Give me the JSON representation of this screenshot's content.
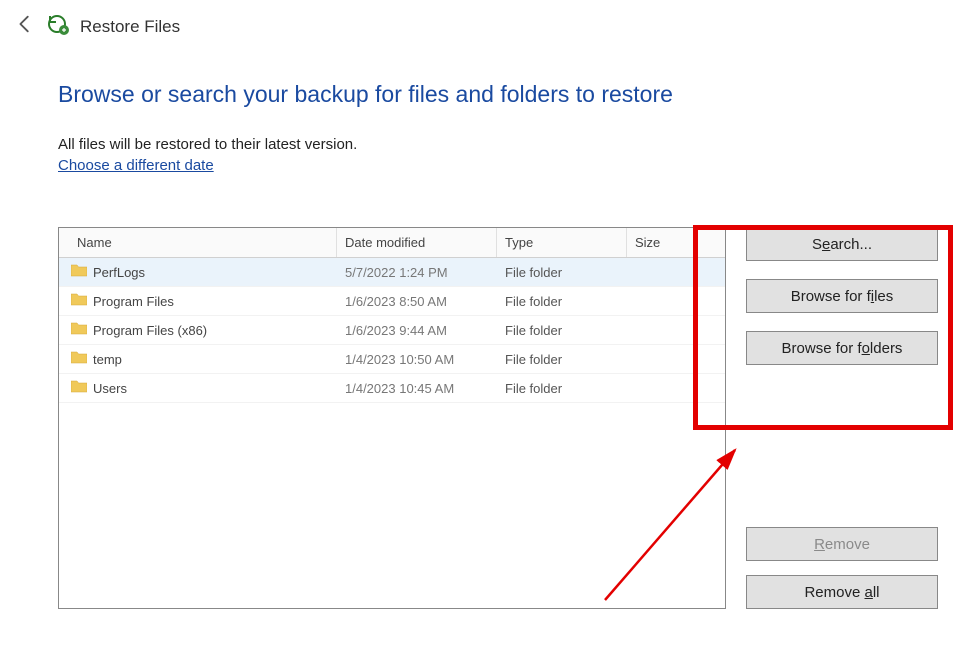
{
  "titlebar": {
    "title": "Restore Files"
  },
  "heading": "Browse or search your backup for files and folders to restore",
  "subtext": "All files will be restored to their latest version.",
  "link": "Choose a different date",
  "columns": {
    "name": "Name",
    "date": "Date modified",
    "type": "Type",
    "size": "Size"
  },
  "rows": [
    {
      "name": "PerfLogs",
      "date": "5/7/2022 1:24 PM",
      "type": "File folder",
      "selected": true
    },
    {
      "name": "Program Files",
      "date": "1/6/2023 8:50 AM",
      "type": "File folder",
      "selected": false
    },
    {
      "name": "Program Files (x86)",
      "date": "1/6/2023 9:44 AM",
      "type": "File folder",
      "selected": false
    },
    {
      "name": "temp",
      "date": "1/4/2023 10:50 AM",
      "type": "File folder",
      "selected": false
    },
    {
      "name": "Users",
      "date": "1/4/2023 10:45 AM",
      "type": "File folder",
      "selected": false
    }
  ],
  "buttons": {
    "search_pre": "S",
    "search_u": "e",
    "search_post": "arch...",
    "browse_files_pre": "Browse for f",
    "browse_files_u": "i",
    "browse_files_post": "les",
    "browse_folders_pre": "Browse for f",
    "browse_folders_u": "o",
    "browse_folders_post": "lders",
    "remove_pre": "",
    "remove_u": "R",
    "remove_post": "emove",
    "remove_all_pre": "Remove ",
    "remove_all_u": "a",
    "remove_all_post": "ll"
  }
}
